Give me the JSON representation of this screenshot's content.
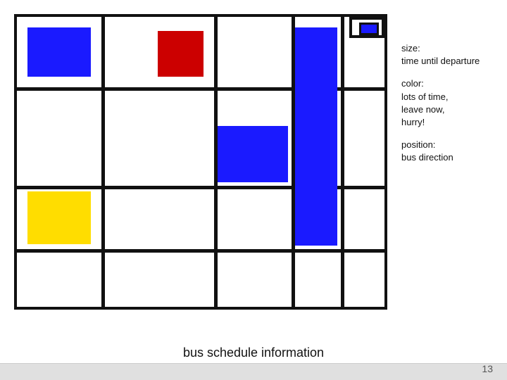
{
  "slide": {
    "title": "bus schedule information",
    "page_number": "13"
  },
  "sidebar": {
    "size_label": "size:",
    "size_desc": "time until departure",
    "color_label": "color:",
    "color_desc": "lots of time,\nleave now,\nhurry!",
    "position_label": "position:",
    "position_desc": "bus direction"
  },
  "blocks": {
    "colors": {
      "blue": "#1a1aff",
      "red": "#cc0000",
      "yellow": "#ffdd00",
      "black": "#111111"
    }
  }
}
